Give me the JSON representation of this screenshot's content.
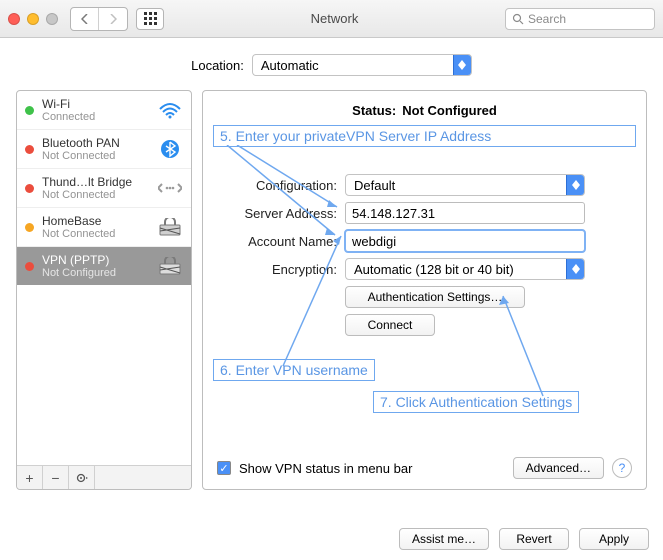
{
  "window": {
    "title": "Network",
    "search_placeholder": "Search"
  },
  "location": {
    "label": "Location:",
    "value": "Automatic"
  },
  "sidebar": {
    "items": [
      {
        "name": "Wi-Fi",
        "status": "Connected",
        "dot": "green",
        "icon": "wifi"
      },
      {
        "name": "Bluetooth PAN",
        "status": "Not Connected",
        "dot": "red",
        "icon": "bluetooth"
      },
      {
        "name": "Thund…lt Bridge",
        "status": "Not Connected",
        "dot": "red",
        "icon": "bridge"
      },
      {
        "name": "HomeBase",
        "status": "Not Connected",
        "dot": "orange",
        "icon": "vpn"
      },
      {
        "name": "VPN (PPTP)",
        "status": "Not Configured",
        "dot": "red",
        "icon": "vpn",
        "selected": true
      }
    ]
  },
  "detail": {
    "status_label": "Status:",
    "status_value": "Not Configured",
    "config_label": "Configuration:",
    "config_value": "Default",
    "server_label": "Server Address:",
    "server_value": "54.148.127.31",
    "account_label": "Account Name:",
    "account_value": "webdigi",
    "encryption_label": "Encryption:",
    "encryption_value": "Automatic (128 bit or 40 bit)",
    "auth_button": "Authentication Settings…",
    "connect_button": "Connect",
    "show_status_label": "Show VPN status in menu bar",
    "advanced_button": "Advanced…"
  },
  "annotations": {
    "a5": "5. Enter your privateVPN Server IP Address",
    "a6": "6. Enter VPN username",
    "a7": "7. Click Authentication Settings"
  },
  "footer": {
    "assist": "Assist me…",
    "revert": "Revert",
    "apply": "Apply"
  }
}
